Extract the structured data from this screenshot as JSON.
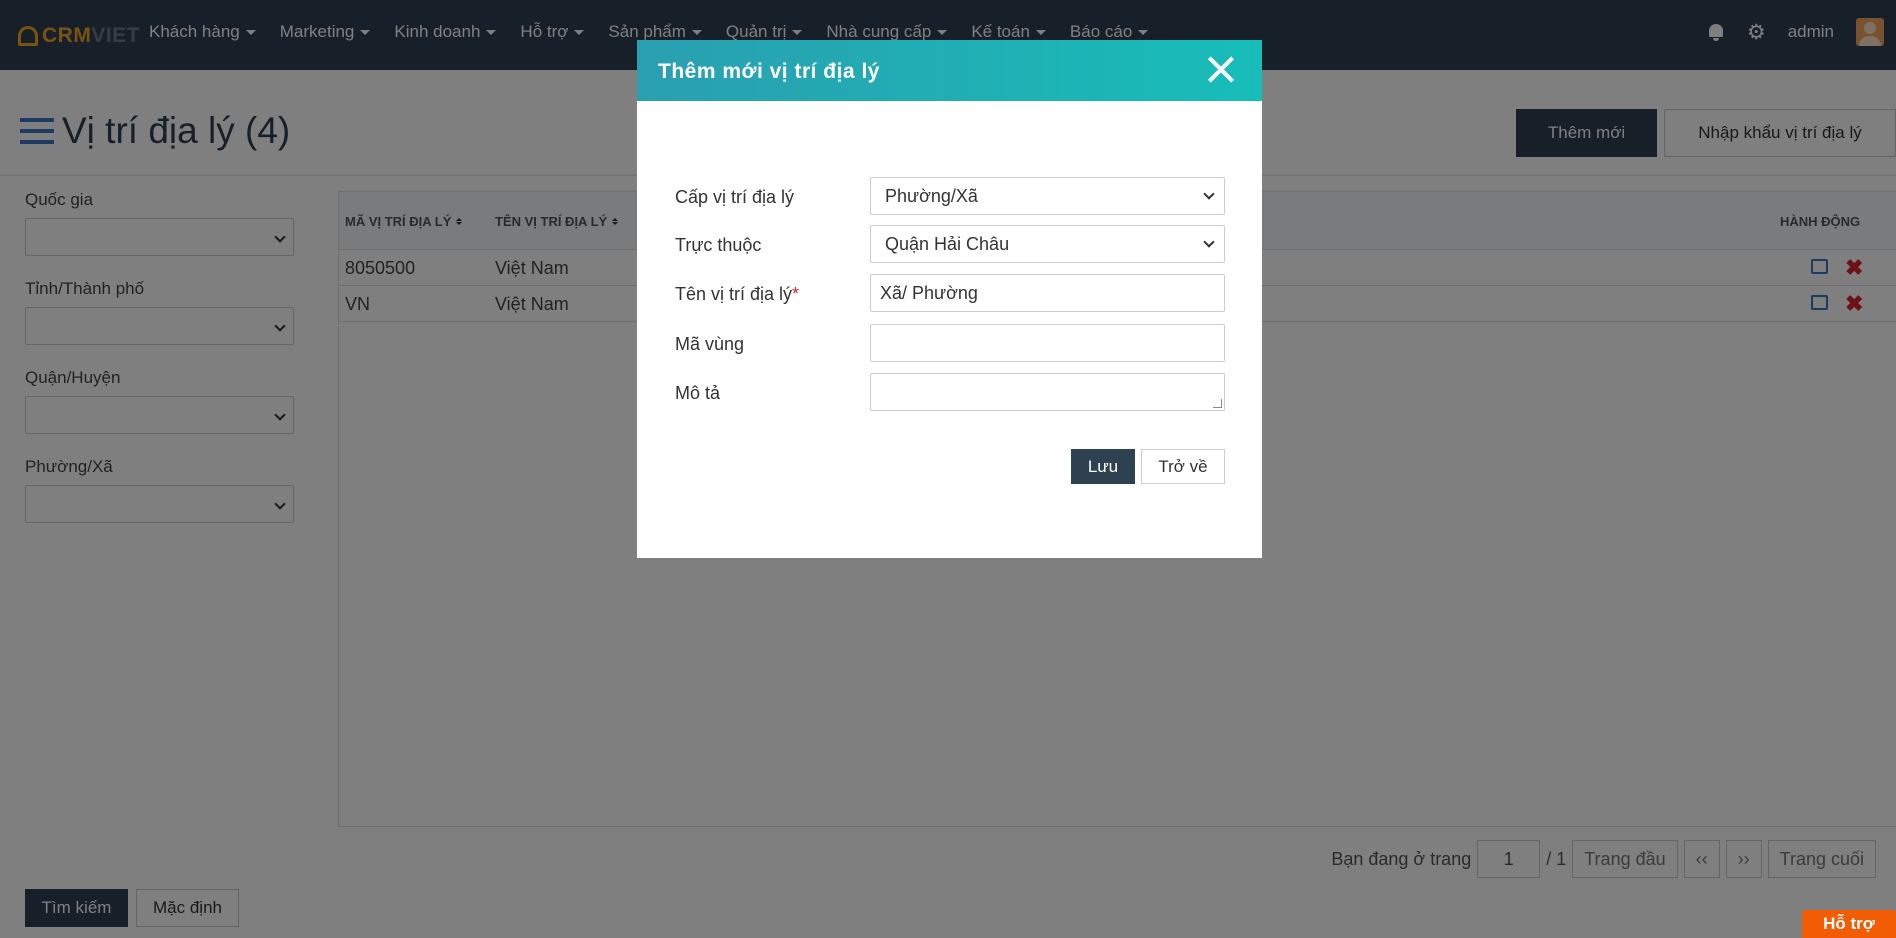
{
  "nav": {
    "logo_a": "CRM",
    "logo_b": "VIET",
    "menu": [
      "Khách hàng",
      "Marketing",
      "Kinh doanh",
      "Hỗ trợ",
      "Sản phẩm",
      "Quản trị",
      "Nhà cung cấp",
      "Kế toán",
      "Báo cáo"
    ],
    "user": "admin",
    "gear_glyph": "⚙"
  },
  "page": {
    "title": "Vị trí địa lý (4)",
    "add_button": "Thêm mới",
    "import_button": "Nhập khẩu vị trí địa lý"
  },
  "filters": {
    "country": "Quốc gia",
    "province": "Tỉnh/Thành phố",
    "district": "Quận/Huyện",
    "ward": "Phường/Xã"
  },
  "table": {
    "columns": [
      "MÃ VỊ TRÍ ĐỊA LÝ",
      "TÊN VỊ TRÍ ĐỊA LÝ",
      "HÀNH ĐỘNG"
    ],
    "rows": [
      {
        "code": "8050500",
        "name": "Việt Nam"
      },
      {
        "code": "VN",
        "name": "Việt Nam"
      }
    ]
  },
  "pager": {
    "label": "Bạn đang ở trang",
    "page": "1",
    "total": "/ 1",
    "first": "Trang đầu",
    "prev": "‹‹",
    "next": "››",
    "last": "Trang cuối"
  },
  "search_button": "Tìm kiếm",
  "reset_button": "Mặc định",
  "help_button": "Hỗ trợ",
  "modal": {
    "title": "Thêm mới vị trí địa lý",
    "level_label": "Cấp vị trí địa lý",
    "level_value": "Phường/Xã",
    "parent_label": "Trực thuộc",
    "parent_value": "Quận Hải Châu",
    "name_label": "Tên vị trí địa lý",
    "required_mark": "*",
    "name_value": "Xã/ Phường",
    "region_label": "Mã vùng",
    "region_value": "",
    "desc_label": "Mô tả",
    "desc_value": "",
    "save_button": "Lưu",
    "back_button": "Trở về"
  }
}
